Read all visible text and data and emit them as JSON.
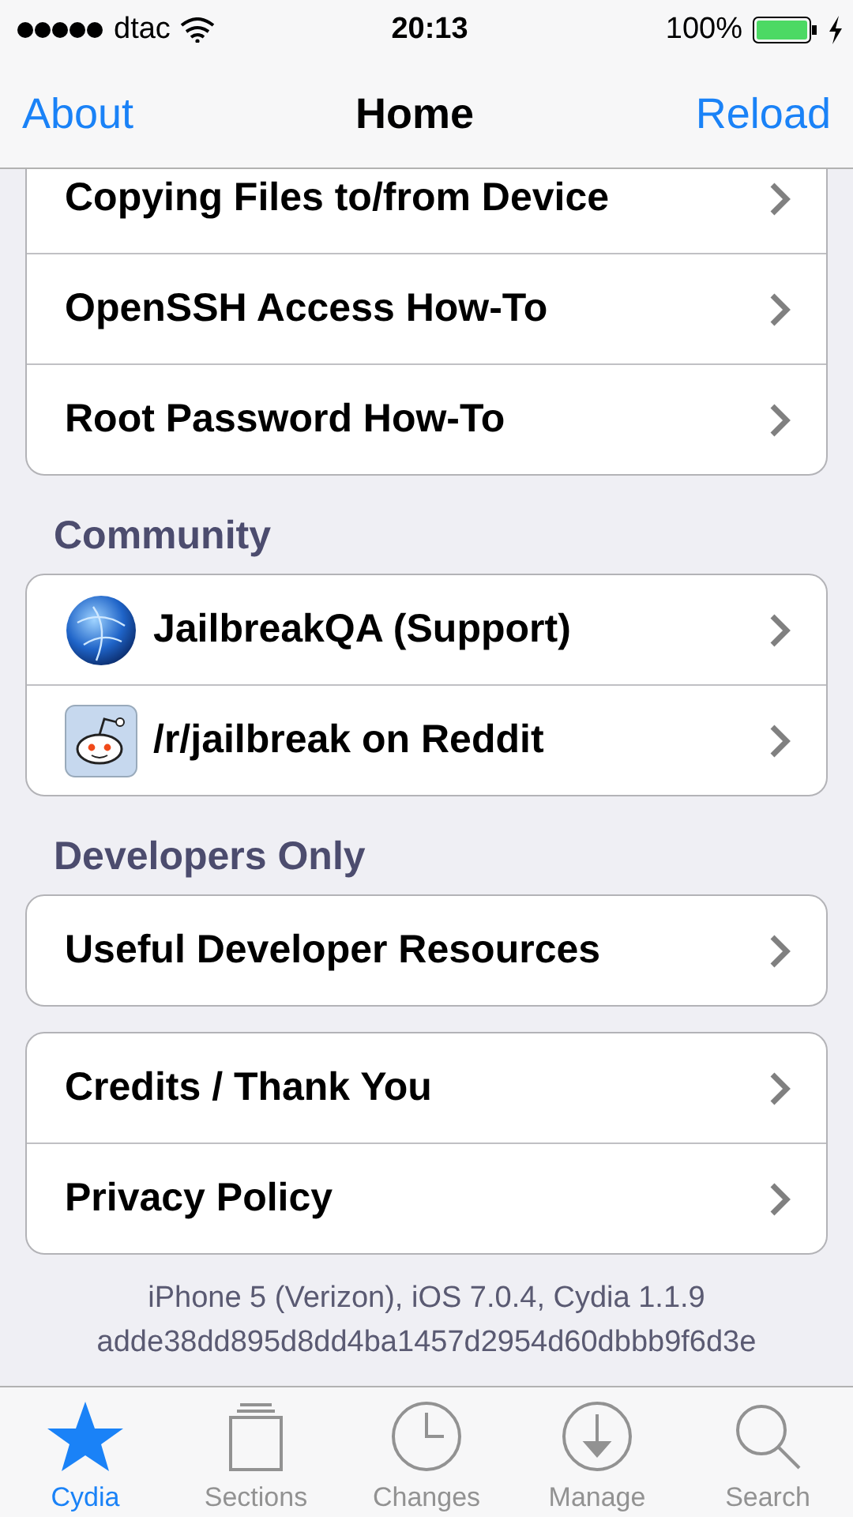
{
  "status_bar": {
    "carrier": "dtac",
    "time": "20:13",
    "battery": "100%",
    "charging": true
  },
  "nav": {
    "left": "About",
    "title": "Home",
    "right": "Reload"
  },
  "groups": [
    {
      "rows": [
        {
          "label": "Copying Files to/from Device",
          "kind": "plain"
        },
        {
          "label": "OpenSSH Access How-To",
          "kind": "plain"
        },
        {
          "label": "Root Password How-To",
          "kind": "plain"
        }
      ]
    },
    {
      "header": "Community",
      "rows": [
        {
          "label": "JailbreakQA (Support)",
          "kind": "globe"
        },
        {
          "label": "/r/jailbreak on Reddit",
          "kind": "reddit"
        }
      ]
    },
    {
      "header": "Developers Only",
      "rows": [
        {
          "label": "Useful Developer Resources",
          "kind": "plain"
        }
      ]
    },
    {
      "rows": [
        {
          "label": "Credits / Thank You",
          "kind": "plain"
        },
        {
          "label": "Privacy Policy",
          "kind": "plain"
        }
      ]
    }
  ],
  "footer": [
    "iPhone 5 (Verizon), iOS 7.0.4, Cydia 1.1.9",
    "adde38dd895d8dd4ba1457d2954d60dbbb9f6d3e"
  ],
  "tabs": [
    {
      "label": "Cydia",
      "kind": "star",
      "selected": true
    },
    {
      "label": "Sections",
      "kind": "sections",
      "selected": false
    },
    {
      "label": "Changes",
      "kind": "clock",
      "selected": false
    },
    {
      "label": "Manage",
      "kind": "download",
      "selected": false
    },
    {
      "label": "Search",
      "kind": "search",
      "selected": false
    }
  ]
}
